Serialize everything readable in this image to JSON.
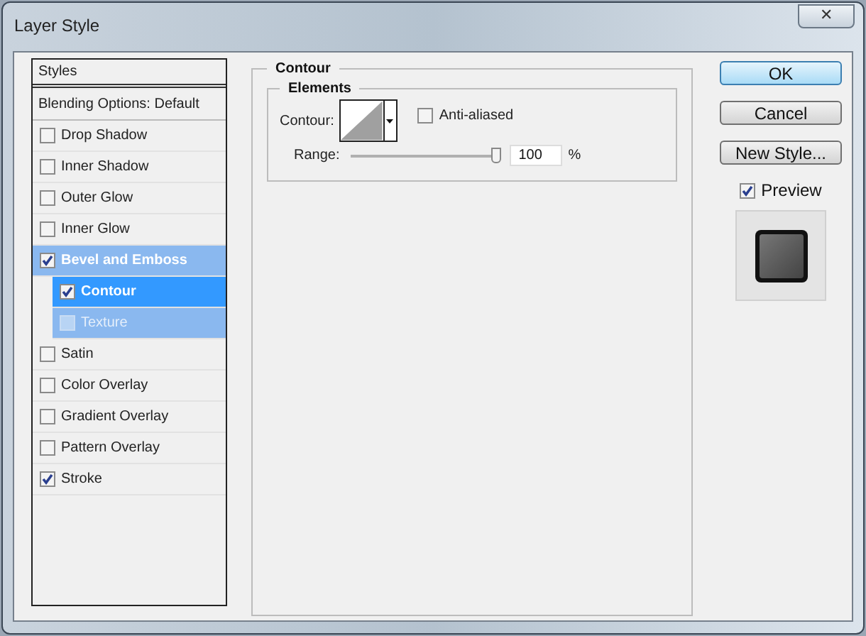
{
  "window": {
    "title": "Layer Style",
    "close": "✕"
  },
  "styles_header": "Styles",
  "blending_options": "Blending Options: Default",
  "effects": [
    {
      "label": "Drop Shadow",
      "checked": false,
      "selected": false
    },
    {
      "label": "Inner Shadow",
      "checked": false,
      "selected": false
    },
    {
      "label": "Outer Glow",
      "checked": false,
      "selected": false
    },
    {
      "label": "Inner Glow",
      "checked": false,
      "selected": false
    },
    {
      "label": "Bevel and Emboss",
      "checked": true,
      "selected": false,
      "expanded": true,
      "children": [
        {
          "label": "Contour",
          "checked": true,
          "selected": true
        },
        {
          "label": "Texture",
          "checked": false,
          "selected": false
        }
      ]
    },
    {
      "label": "Satin",
      "checked": false,
      "selected": false
    },
    {
      "label": "Color Overlay",
      "checked": false,
      "selected": false
    },
    {
      "label": "Gradient Overlay",
      "checked": false,
      "selected": false
    },
    {
      "label": "Pattern Overlay",
      "checked": false,
      "selected": false
    },
    {
      "label": "Stroke",
      "checked": true,
      "selected": false
    }
  ],
  "panel": {
    "title": "Contour",
    "group": "Elements",
    "contour_label": "Contour:",
    "anti_aliased": {
      "label": "Anti-aliased",
      "checked": false
    },
    "range": {
      "label": "Range:",
      "level": 1,
      "value": "100",
      "unit": "%"
    }
  },
  "buttons": [
    {
      "label": "OK",
      "default": true
    },
    {
      "label": "Cancel",
      "default": false
    },
    {
      "label": "New Style...",
      "default": false
    }
  ],
  "preview": {
    "label": "Preview",
    "checked": true
  }
}
